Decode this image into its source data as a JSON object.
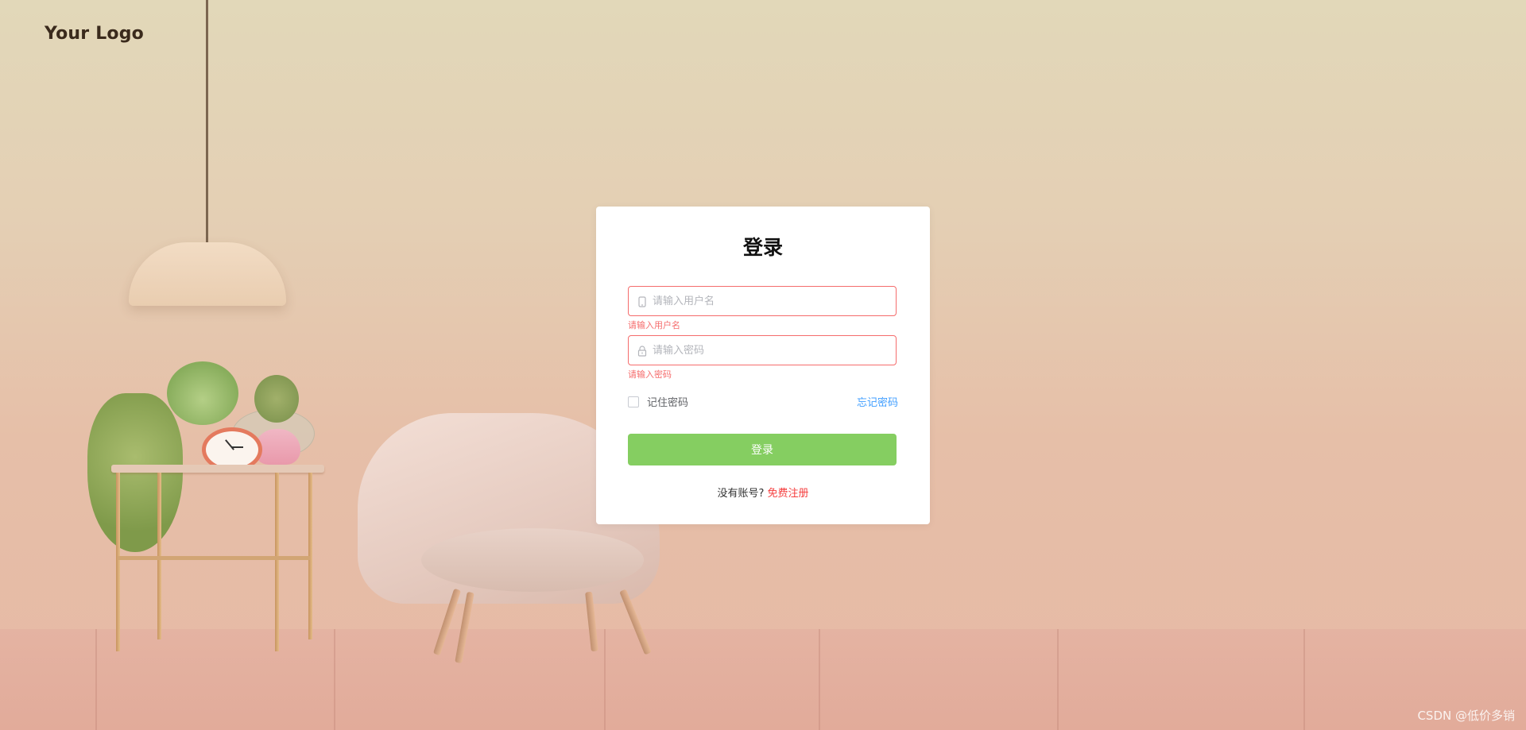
{
  "brand": {
    "logo_text": "Your Logo"
  },
  "login": {
    "title": "登录",
    "username": {
      "placeholder": "请输入用户名",
      "value": "",
      "error": "请输入用户名",
      "icon": "phone-icon"
    },
    "password": {
      "placeholder": "请输入密码",
      "value": "",
      "error": "请输入密码",
      "icon": "lock-icon"
    },
    "remember_label": "记住密码",
    "remember_checked": false,
    "forgot_label": "忘记密码",
    "submit_label": "登录",
    "no_account_text": "没有账号?",
    "register_label": "免费注册"
  },
  "colors": {
    "error": "#f56c6c",
    "link": "#409eff",
    "button": "#85ce61",
    "register_link": "#f53d3d"
  },
  "watermark": "CSDN @低价多销"
}
